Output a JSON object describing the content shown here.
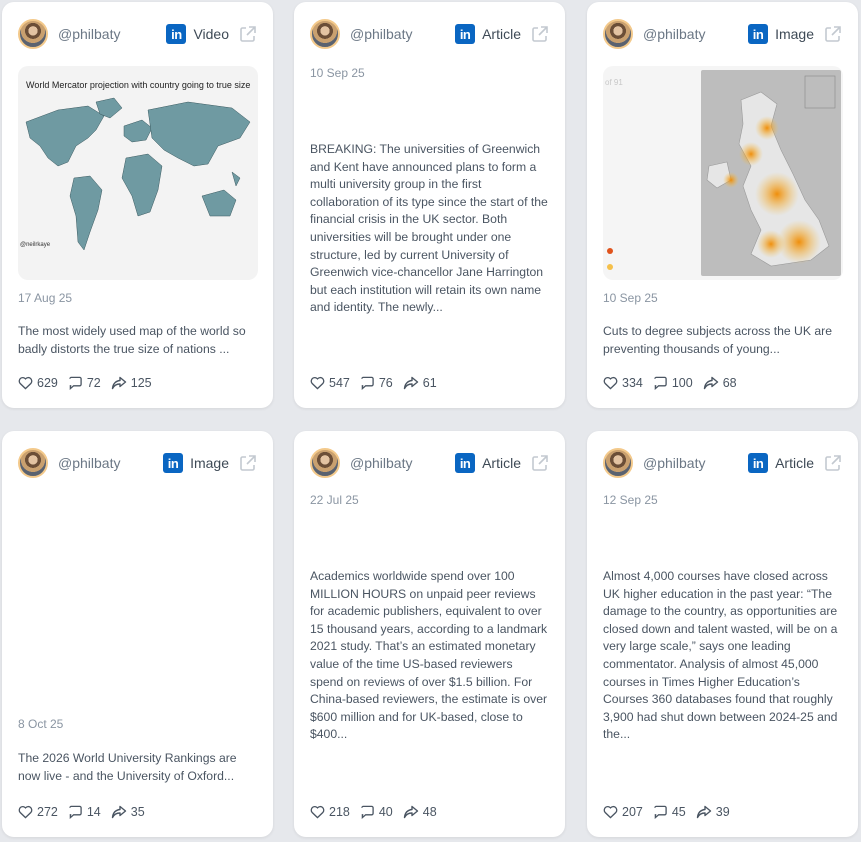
{
  "cards": [
    {
      "handle": "@philbaty",
      "type": "Video",
      "date": "17 Aug 25",
      "text": "The most widely used map of the world so badly distorts the true size of nations ...",
      "media_title": "World Mercator projection with country going to true size",
      "media_credit": "@neilrkaye",
      "likes": "629",
      "comments": "72",
      "shares": "125"
    },
    {
      "handle": "@philbaty",
      "type": "Article",
      "date": "10 Sep 25",
      "text": "BREAKING: The universities of Greenwich and Kent have announced plans to form a multi university group in the first collaboration of its type since the start of the financial crisis in the UK sector. Both universities will be brought under one structure, led by current University of Greenwich vice-chancellor Jane Harrington but each institution will retain its own name and identity. The newly...",
      "likes": "547",
      "comments": "76",
      "shares": "61"
    },
    {
      "handle": "@philbaty",
      "type": "Image",
      "date": "10 Sep 25",
      "text": "Cuts to degree subjects across the UK are preventing thousands of young...",
      "media_page": "of 91",
      "likes": "334",
      "comments": "100",
      "shares": "68"
    },
    {
      "handle": "@philbaty",
      "type": "Image",
      "date": "8 Oct 25",
      "text": "The 2026 World University Rankings are now live - and the University of Oxford...",
      "likes": "272",
      "comments": "14",
      "shares": "35"
    },
    {
      "handle": "@philbaty",
      "type": "Article",
      "date": "22 Jul 25",
      "text": "Academics worldwide spend over 100 MILLION HOURS on unpaid peer reviews for academic publishers, equivalent to over 15 thousand years, according to a landmark 2021 study. That’s an estimated monetary value of the time US-based reviewers spend on reviews of over $1.5 billion. For China-based reviewers, the estimate is over $600 million and for UK-based, close to $400...",
      "likes": "218",
      "comments": "40",
      "shares": "48"
    },
    {
      "handle": "@philbaty",
      "type": "Article",
      "date": "12 Sep 25",
      "text": "Almost 4,000 courses have closed across UK higher education in the past year: “The damage to the country, as opportunities are closed down and talent wasted, will be on a very large scale,” says one leading commentator. Analysis of almost 45,000 courses in Times Higher Education’s Courses 360 databases found that roughly 3,900 had shut down between 2024-25 and the...",
      "likes": "207",
      "comments": "45",
      "shares": "39"
    }
  ],
  "colors": {
    "linkedin": "#0a66c2",
    "uk_hotspot": "#f08a00"
  }
}
